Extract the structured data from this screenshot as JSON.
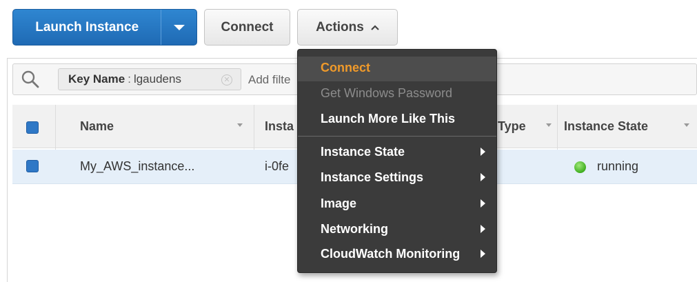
{
  "toolbar": {
    "launch_label": "Launch Instance",
    "connect_label": "Connect",
    "actions_label": "Actions"
  },
  "filter": {
    "token_key": "Key Name",
    "token_separator": ":",
    "token_value": "lgaudens",
    "placeholder": "Add filte"
  },
  "table": {
    "columns": [
      {
        "label": "Name"
      },
      {
        "label": "Insta"
      },
      {
        "label": "Type"
      },
      {
        "label": "Instance State"
      }
    ],
    "rows": [
      {
        "name": "My_AWS_instance...",
        "instance_id": "i-0fe",
        "state": "running",
        "state_color": "#3fae1f"
      }
    ]
  },
  "actions_menu": {
    "items": [
      {
        "label": "Connect",
        "state": "active"
      },
      {
        "label": "Get Windows Password",
        "state": "disabled"
      },
      {
        "label": "Launch More Like This",
        "state": "normal"
      },
      {
        "label": "Instance State",
        "submenu": true
      },
      {
        "label": "Instance Settings",
        "submenu": true
      },
      {
        "label": "Image",
        "submenu": true
      },
      {
        "label": "Networking",
        "submenu": true
      },
      {
        "label": "CloudWatch Monitoring",
        "submenu": true
      }
    ]
  },
  "colors": {
    "primary_button": "#1f6ab4",
    "menu_background": "#3b3b3b",
    "menu_active_text": "#f09a2a",
    "row_selected": "#e5eff9",
    "status_running": "#3fae1f"
  }
}
